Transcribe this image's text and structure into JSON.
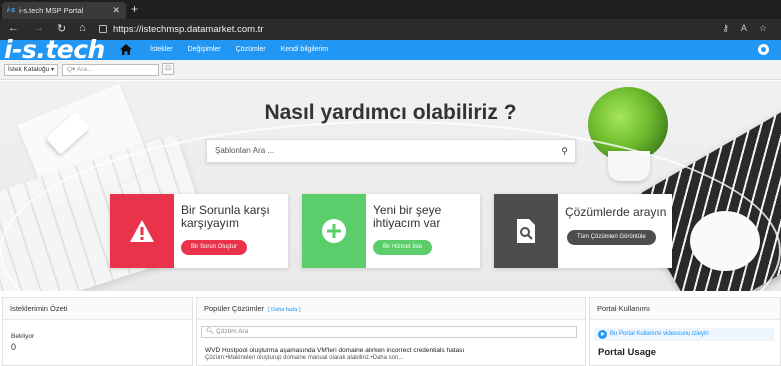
{
  "browser": {
    "tab_title": "i-s.tech MSP Portal",
    "tab_favicon": "i-s",
    "url": "https://istechmsp.datamarket.com.tr"
  },
  "header": {
    "logo": "i-s.tech",
    "nav": [
      "İstekler",
      "Değişimler",
      "Çözümler",
      "Kendi bilgilerim"
    ],
    "brand_color": "#2196f3"
  },
  "subbar": {
    "catalog_select": "İstek Kataloğu",
    "search_placeholder": "Ara..."
  },
  "hero": {
    "title": "Nasıl yardımcı olabiliriz ?",
    "search_placeholder": "Şablonları Ara ...",
    "cards": [
      {
        "title_line1": "Bir Sorunla karşı",
        "title_line2": "karşıyayım",
        "button": "Bir Sorun Oluştur",
        "color": "#e8334a",
        "icon": "warning-icon"
      },
      {
        "title_line1": "Yeni bir şeye",
        "title_line2": "ihtiyacım var",
        "button": "Bir Hizmet İste",
        "color": "#5ccd6b",
        "icon": "plus-icon"
      },
      {
        "title_line1": "Çözümlerde arayın",
        "title_line2": "",
        "button": "Tüm Çözümleri Görüntüle",
        "color": "#4d4d4d",
        "icon": "document-search-icon"
      }
    ]
  },
  "panels": {
    "summary": {
      "title": "İsteklerimin Özeti",
      "status_label": "Bekliyor",
      "status_value": "0"
    },
    "popular": {
      "title": "Popüler Çözümler",
      "more": "[ Daha fazla ]",
      "search_placeholder": "Çözüm Ara",
      "item_title": "WVD Hostpool oluşturma aşamasında VM'leri domaine alırken incorrect credentials hatası",
      "item_desc": "Çözüm:•Makineleri oluşturup domaine manual olarak alabiliriz.•Daha son..."
    },
    "usage": {
      "title": "Portal Kullanımı",
      "video_link": "Bu Portal Kullanımı videosunu izleyin",
      "heading": "Portal Usage"
    }
  }
}
